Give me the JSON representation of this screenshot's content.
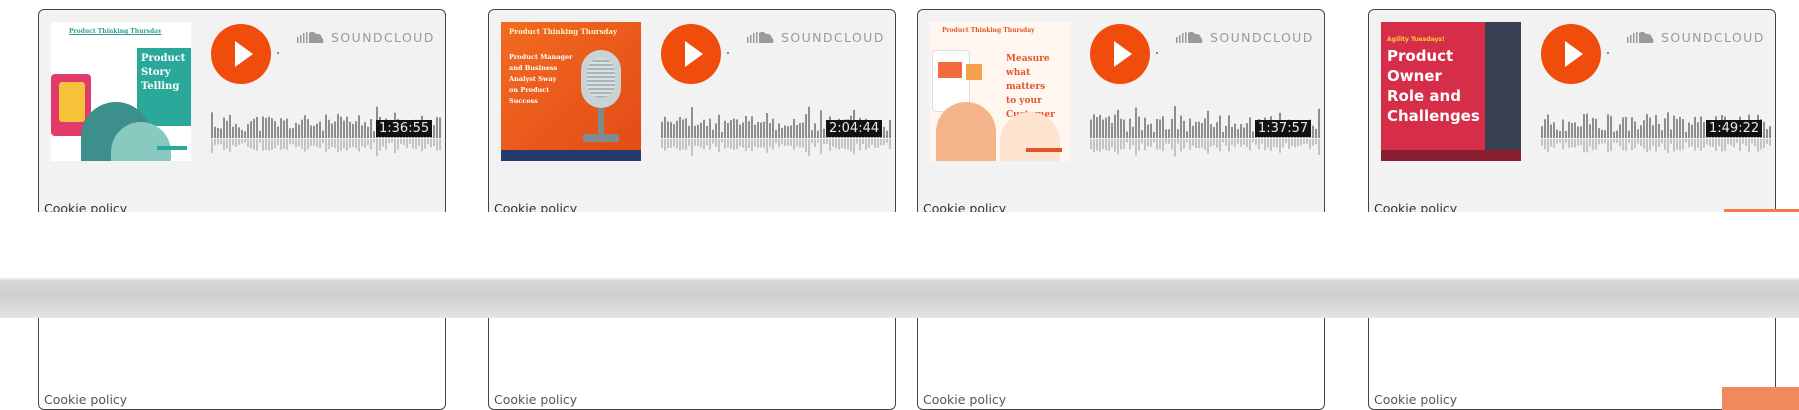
{
  "cards": [
    {
      "brand": "SOUNDCLOUD",
      "duration": "1:36:55",
      "cookie": "Cookie policy",
      "art": {
        "header": "Product Thinking Thursday",
        "title_lines": [
          "Product",
          "Story",
          "Telling"
        ]
      }
    },
    {
      "brand": "SOUNDCLOUD",
      "duration": "2:04:44",
      "cookie": "Cookie policy",
      "art": {
        "header": "Product Thinking Thursday",
        "title_lines": [
          "Product Manager",
          "and Business",
          "Analyst Sway",
          "on Product",
          "Success"
        ]
      }
    },
    {
      "brand": "SOUNDCLOUD",
      "duration": "1:37:57",
      "cookie": "Cookie policy",
      "art": {
        "header": "Product Thinking Thursday",
        "title_lines": [
          "Measure",
          "what",
          "matters",
          "to your",
          "Customer"
        ]
      }
    },
    {
      "brand": "SOUNDCLOUD",
      "duration": "1:49:22",
      "cookie": "Cookie policy",
      "art": {
        "header": "Agility Tuesdays!",
        "title_lines": [
          "Product",
          "Owner",
          "Role and",
          "Challenges"
        ]
      }
    }
  ],
  "icons": {
    "play": "play-icon",
    "soundcloud": "soundcloud-logo-icon"
  },
  "colors": {
    "play": "#f04c0c",
    "accent": "#f37a4e"
  }
}
